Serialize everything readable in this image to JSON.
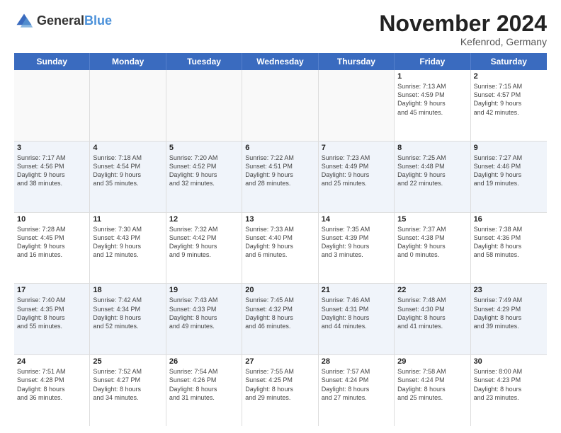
{
  "header": {
    "logo_general": "General",
    "logo_blue": "Blue",
    "month_title": "November 2024",
    "location": "Kefenrod, Germany"
  },
  "days_of_week": [
    "Sunday",
    "Monday",
    "Tuesday",
    "Wednesday",
    "Thursday",
    "Friday",
    "Saturday"
  ],
  "weeks": [
    [
      {
        "day": "",
        "info": ""
      },
      {
        "day": "",
        "info": ""
      },
      {
        "day": "",
        "info": ""
      },
      {
        "day": "",
        "info": ""
      },
      {
        "day": "",
        "info": ""
      },
      {
        "day": "1",
        "info": "Sunrise: 7:13 AM\nSunset: 4:59 PM\nDaylight: 9 hours\nand 45 minutes."
      },
      {
        "day": "2",
        "info": "Sunrise: 7:15 AM\nSunset: 4:57 PM\nDaylight: 9 hours\nand 42 minutes."
      }
    ],
    [
      {
        "day": "3",
        "info": "Sunrise: 7:17 AM\nSunset: 4:56 PM\nDaylight: 9 hours\nand 38 minutes."
      },
      {
        "day": "4",
        "info": "Sunrise: 7:18 AM\nSunset: 4:54 PM\nDaylight: 9 hours\nand 35 minutes."
      },
      {
        "day": "5",
        "info": "Sunrise: 7:20 AM\nSunset: 4:52 PM\nDaylight: 9 hours\nand 32 minutes."
      },
      {
        "day": "6",
        "info": "Sunrise: 7:22 AM\nSunset: 4:51 PM\nDaylight: 9 hours\nand 28 minutes."
      },
      {
        "day": "7",
        "info": "Sunrise: 7:23 AM\nSunset: 4:49 PM\nDaylight: 9 hours\nand 25 minutes."
      },
      {
        "day": "8",
        "info": "Sunrise: 7:25 AM\nSunset: 4:48 PM\nDaylight: 9 hours\nand 22 minutes."
      },
      {
        "day": "9",
        "info": "Sunrise: 7:27 AM\nSunset: 4:46 PM\nDaylight: 9 hours\nand 19 minutes."
      }
    ],
    [
      {
        "day": "10",
        "info": "Sunrise: 7:28 AM\nSunset: 4:45 PM\nDaylight: 9 hours\nand 16 minutes."
      },
      {
        "day": "11",
        "info": "Sunrise: 7:30 AM\nSunset: 4:43 PM\nDaylight: 9 hours\nand 12 minutes."
      },
      {
        "day": "12",
        "info": "Sunrise: 7:32 AM\nSunset: 4:42 PM\nDaylight: 9 hours\nand 9 minutes."
      },
      {
        "day": "13",
        "info": "Sunrise: 7:33 AM\nSunset: 4:40 PM\nDaylight: 9 hours\nand 6 minutes."
      },
      {
        "day": "14",
        "info": "Sunrise: 7:35 AM\nSunset: 4:39 PM\nDaylight: 9 hours\nand 3 minutes."
      },
      {
        "day": "15",
        "info": "Sunrise: 7:37 AM\nSunset: 4:38 PM\nDaylight: 9 hours\nand 0 minutes."
      },
      {
        "day": "16",
        "info": "Sunrise: 7:38 AM\nSunset: 4:36 PM\nDaylight: 8 hours\nand 58 minutes."
      }
    ],
    [
      {
        "day": "17",
        "info": "Sunrise: 7:40 AM\nSunset: 4:35 PM\nDaylight: 8 hours\nand 55 minutes."
      },
      {
        "day": "18",
        "info": "Sunrise: 7:42 AM\nSunset: 4:34 PM\nDaylight: 8 hours\nand 52 minutes."
      },
      {
        "day": "19",
        "info": "Sunrise: 7:43 AM\nSunset: 4:33 PM\nDaylight: 8 hours\nand 49 minutes."
      },
      {
        "day": "20",
        "info": "Sunrise: 7:45 AM\nSunset: 4:32 PM\nDaylight: 8 hours\nand 46 minutes."
      },
      {
        "day": "21",
        "info": "Sunrise: 7:46 AM\nSunset: 4:31 PM\nDaylight: 8 hours\nand 44 minutes."
      },
      {
        "day": "22",
        "info": "Sunrise: 7:48 AM\nSunset: 4:30 PM\nDaylight: 8 hours\nand 41 minutes."
      },
      {
        "day": "23",
        "info": "Sunrise: 7:49 AM\nSunset: 4:29 PM\nDaylight: 8 hours\nand 39 minutes."
      }
    ],
    [
      {
        "day": "24",
        "info": "Sunrise: 7:51 AM\nSunset: 4:28 PM\nDaylight: 8 hours\nand 36 minutes."
      },
      {
        "day": "25",
        "info": "Sunrise: 7:52 AM\nSunset: 4:27 PM\nDaylight: 8 hours\nand 34 minutes."
      },
      {
        "day": "26",
        "info": "Sunrise: 7:54 AM\nSunset: 4:26 PM\nDaylight: 8 hours\nand 31 minutes."
      },
      {
        "day": "27",
        "info": "Sunrise: 7:55 AM\nSunset: 4:25 PM\nDaylight: 8 hours\nand 29 minutes."
      },
      {
        "day": "28",
        "info": "Sunrise: 7:57 AM\nSunset: 4:24 PM\nDaylight: 8 hours\nand 27 minutes."
      },
      {
        "day": "29",
        "info": "Sunrise: 7:58 AM\nSunset: 4:24 PM\nDaylight: 8 hours\nand 25 minutes."
      },
      {
        "day": "30",
        "info": "Sunrise: 8:00 AM\nSunset: 4:23 PM\nDaylight: 8 hours\nand 23 minutes."
      }
    ]
  ]
}
